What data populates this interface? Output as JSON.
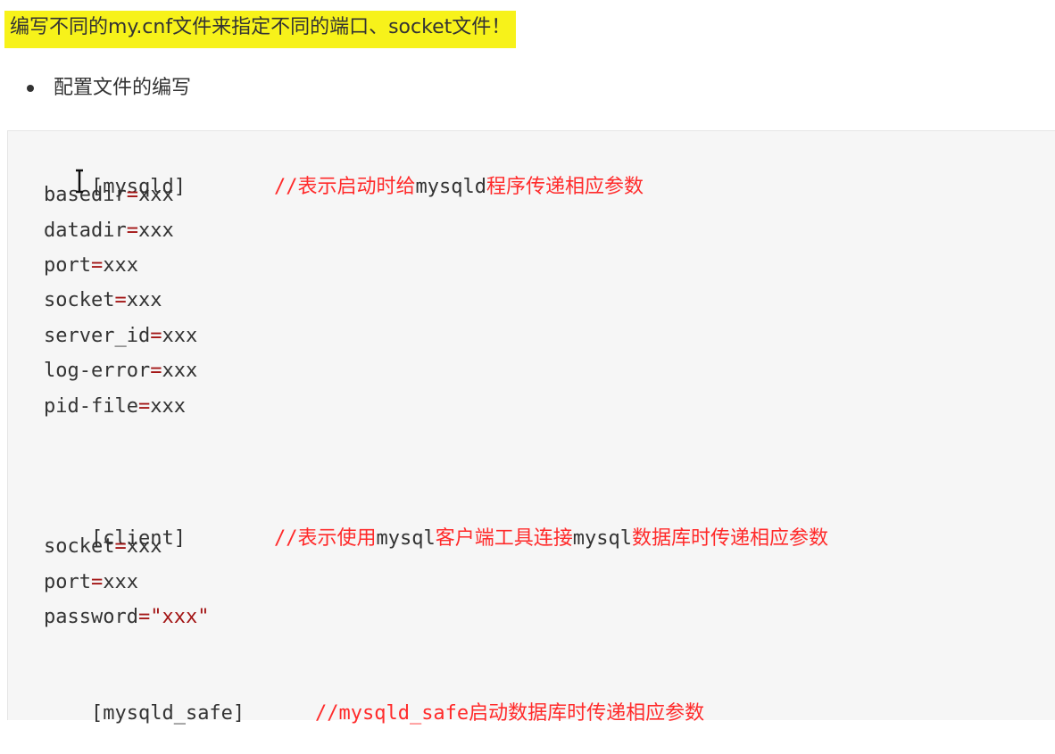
{
  "heading": "编写不同的my.cnf文件来指定不同的端口、socket文件！",
  "bullet": "配置文件的编写",
  "code": {
    "mysqld": {
      "header": "[mysqld]",
      "comment_prefix": "//表示启动时给",
      "comment_mono": "mysqld",
      "comment_suffix": "程序传递相应参数",
      "lines": [
        {
          "key": "basedir",
          "value": "xxx"
        },
        {
          "key": "datadir",
          "value": "xxx"
        },
        {
          "key": "port",
          "value": "xxx"
        },
        {
          "key": "socket",
          "value": "xxx"
        },
        {
          "key": "server_id",
          "value": "xxx"
        },
        {
          "key": "log-error",
          "value": "xxx"
        },
        {
          "key": "pid-file",
          "value": "xxx"
        }
      ]
    },
    "client": {
      "header": "[client]",
      "comment_prefix": "//表示使用",
      "comment_mono1": "mysql",
      "comment_mid": "客户端工具连接",
      "comment_mono2": "mysql",
      "comment_suffix": "数据库时传递相应参数",
      "lines": [
        {
          "key": "socket",
          "value": "xxx"
        },
        {
          "key": "port",
          "value": "xxx"
        },
        {
          "key": "password",
          "value": "\"xxx\""
        }
      ]
    },
    "mysqld_safe": {
      "header": "[mysqld_safe]",
      "comment_mono": "//mysqld_safe",
      "comment_suffix": "启动数据库时传递相应参数"
    },
    "equals": "="
  }
}
